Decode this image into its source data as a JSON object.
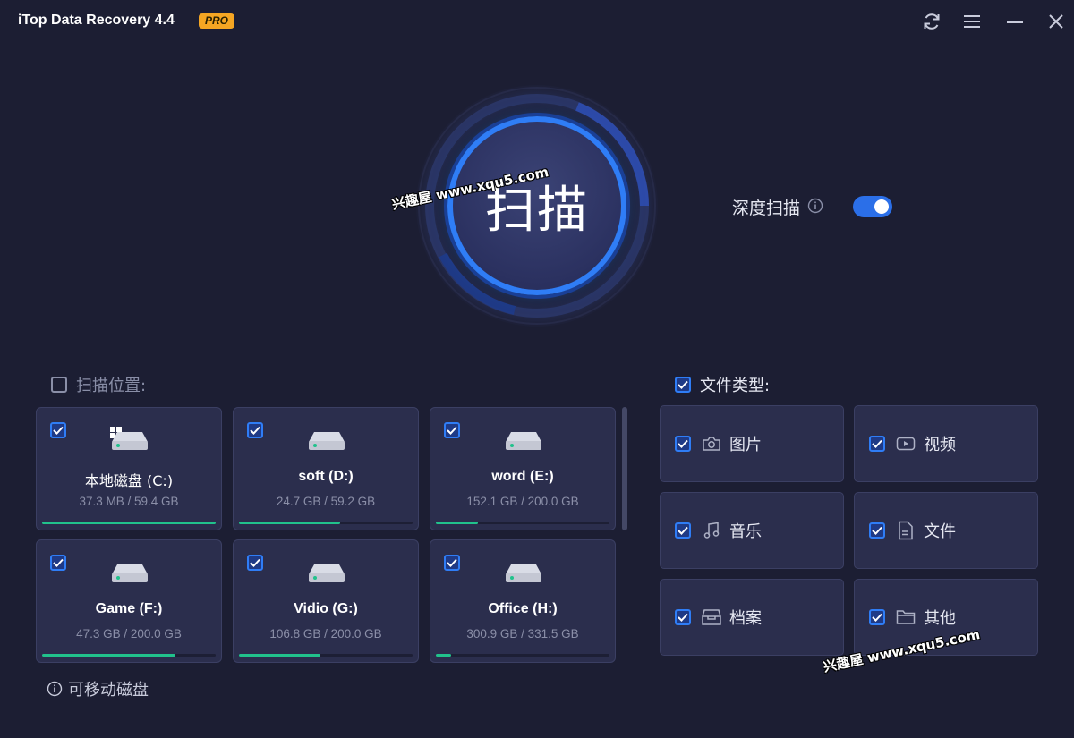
{
  "app": {
    "title": "iTop Data Recovery 4.4",
    "badge": "PRO"
  },
  "window_controls": [
    "refresh-icon",
    "menu-icon",
    "minimize-icon",
    "close-icon"
  ],
  "scan": {
    "label": "扫描"
  },
  "deep_scan": {
    "label": "深度扫描",
    "enabled": true
  },
  "scan_location": {
    "label": "扫描位置:",
    "checked": false
  },
  "drives": [
    {
      "name": "本地磁盘",
      "letter": "(C:)",
      "display": "本地磁盘 (C:)",
      "size": "37.3 MB / 59.4 GB",
      "used_fraction": 0.999,
      "checked": true,
      "system": true
    },
    {
      "name": "soft",
      "letter": "(D:)",
      "display": "soft (D:)",
      "size": "24.7 GB / 59.2 GB",
      "used_fraction": 0.58,
      "checked": true,
      "system": false
    },
    {
      "name": "word",
      "letter": "(E:)",
      "display": "word (E:)",
      "size": "152.1 GB / 200.0 GB",
      "used_fraction": 0.24,
      "checked": true,
      "system": false
    },
    {
      "name": "Game",
      "letter": "(F:)",
      "display": "Game (F:)",
      "size": "47.3 GB / 200.0 GB",
      "used_fraction": 0.77,
      "checked": true,
      "system": false
    },
    {
      "name": "Vidio",
      "letter": "(G:)",
      "display": "Vidio (G:)",
      "size": "106.8 GB / 200.0 GB",
      "used_fraction": 0.47,
      "checked": true,
      "system": false
    },
    {
      "name": "Office",
      "letter": "(H:)",
      "display": "Office (H:)",
      "size": "300.9 GB / 331.5 GB",
      "used_fraction": 0.09,
      "checked": true,
      "system": false
    }
  ],
  "removable": {
    "label": "可移动磁盘"
  },
  "file_types": {
    "label": "文件类型:",
    "checked": true,
    "items": [
      {
        "label": "图片",
        "icon": "camera-icon",
        "checked": true
      },
      {
        "label": "视频",
        "icon": "video-icon",
        "checked": true
      },
      {
        "label": "音乐",
        "icon": "music-icon",
        "checked": true
      },
      {
        "label": "文件",
        "icon": "document-icon",
        "checked": true
      },
      {
        "label": "档案",
        "icon": "archive-icon",
        "checked": true
      },
      {
        "label": "其他",
        "icon": "folder-icon",
        "checked": true
      }
    ]
  },
  "watermark": "兴趣屋 www.xqu5.com",
  "colors": {
    "background": "#1c1e33",
    "card": "#2b2e4d",
    "accent": "#2f7df6",
    "progress": "#21c28c",
    "badge": "#f5a623"
  }
}
